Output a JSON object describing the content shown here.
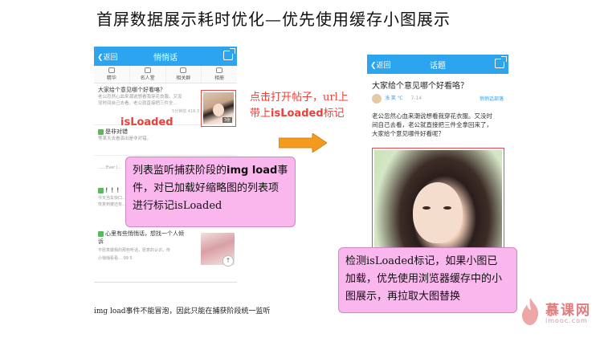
{
  "slide": {
    "title": "首屏数据展示耗时优化—优先使用缓存小图展示",
    "footnote": "img load事件不能冒泡，因此只能在捕获阶段统一监听"
  },
  "left_phone": {
    "back": "❮返回",
    "title": "悄悄话",
    "tabs": [
      {
        "label": "精华",
        "icon": "gem-icon"
      },
      {
        "label": "名人堂",
        "icon": "people-icon"
      },
      {
        "label": "相关群",
        "icon": "group-icon"
      },
      {
        "label": "相册",
        "icon": "album-icon"
      }
    ],
    "post1": {
      "title": "大家给个意见哪个好看咯？",
      "excerpt": [
        "老公忽然心血来潮说想看我穿花衣服。又没",
        "没时间自己去看，老公就直接把三件全…"
      ],
      "meta": "5分钟前   418   3",
      "thumb_badge": "3张"
    },
    "isloaded": "isLoaded",
    "post2": {
      "title": "是非对错",
      "excerpt": "等某天去看演出是非对错。"
    },
    "fade_rows": [
      "……Ever l…",
      "！！！",
      "今天当车快口…",
      "恢复到被还有…",
      "心里有些悄悄话，想找一个人倾",
      "诉",
      "不愿意做我的那些听话，愿意的认识，传",
      "小悄悄看看…   99   5"
    ],
    "thumb2_btn": "↑"
  },
  "red_note": {
    "line1": "点击打开帖子，url上",
    "line2_prefix": "带上",
    "line2_bold": "isLoaded",
    "line2_suffix": "标记"
  },
  "note1": {
    "line1_prefix": "列表监听捕获阶段的",
    "line1_bold": "img load",
    "line1_suffix": "事",
    "line2": "件，对已加载好缩略图的列表项",
    "line3": "进行标记isLoaded"
  },
  "right_phone": {
    "back": "❮返回",
    "title": "话题",
    "detail_title": "大家给个意见哪个好看咯？",
    "author": "浅 笑 ℃",
    "time": "7-14",
    "section": "悄悄话部落",
    "body": [
      "老公忽然心血来潮说想看我穿花衣服。又没时",
      "间自己去看，老公就直接把三件全拿回来了，",
      "大家给个意见哪件好看呢？"
    ]
  },
  "note2": {
    "line1": "检测isLoaded标记，如果小图已",
    "line2": "加载，优先使用浏览器缓存中的小",
    "line3": "图展示，再拉取大图替换"
  },
  "logo": {
    "name": "慕课网",
    "sub": "imooc.com"
  },
  "colors": {
    "accent": "#2da4ee",
    "note_bg": "#f9b7ee",
    "red": "#e8413b",
    "arrow": "#f39a1f"
  }
}
